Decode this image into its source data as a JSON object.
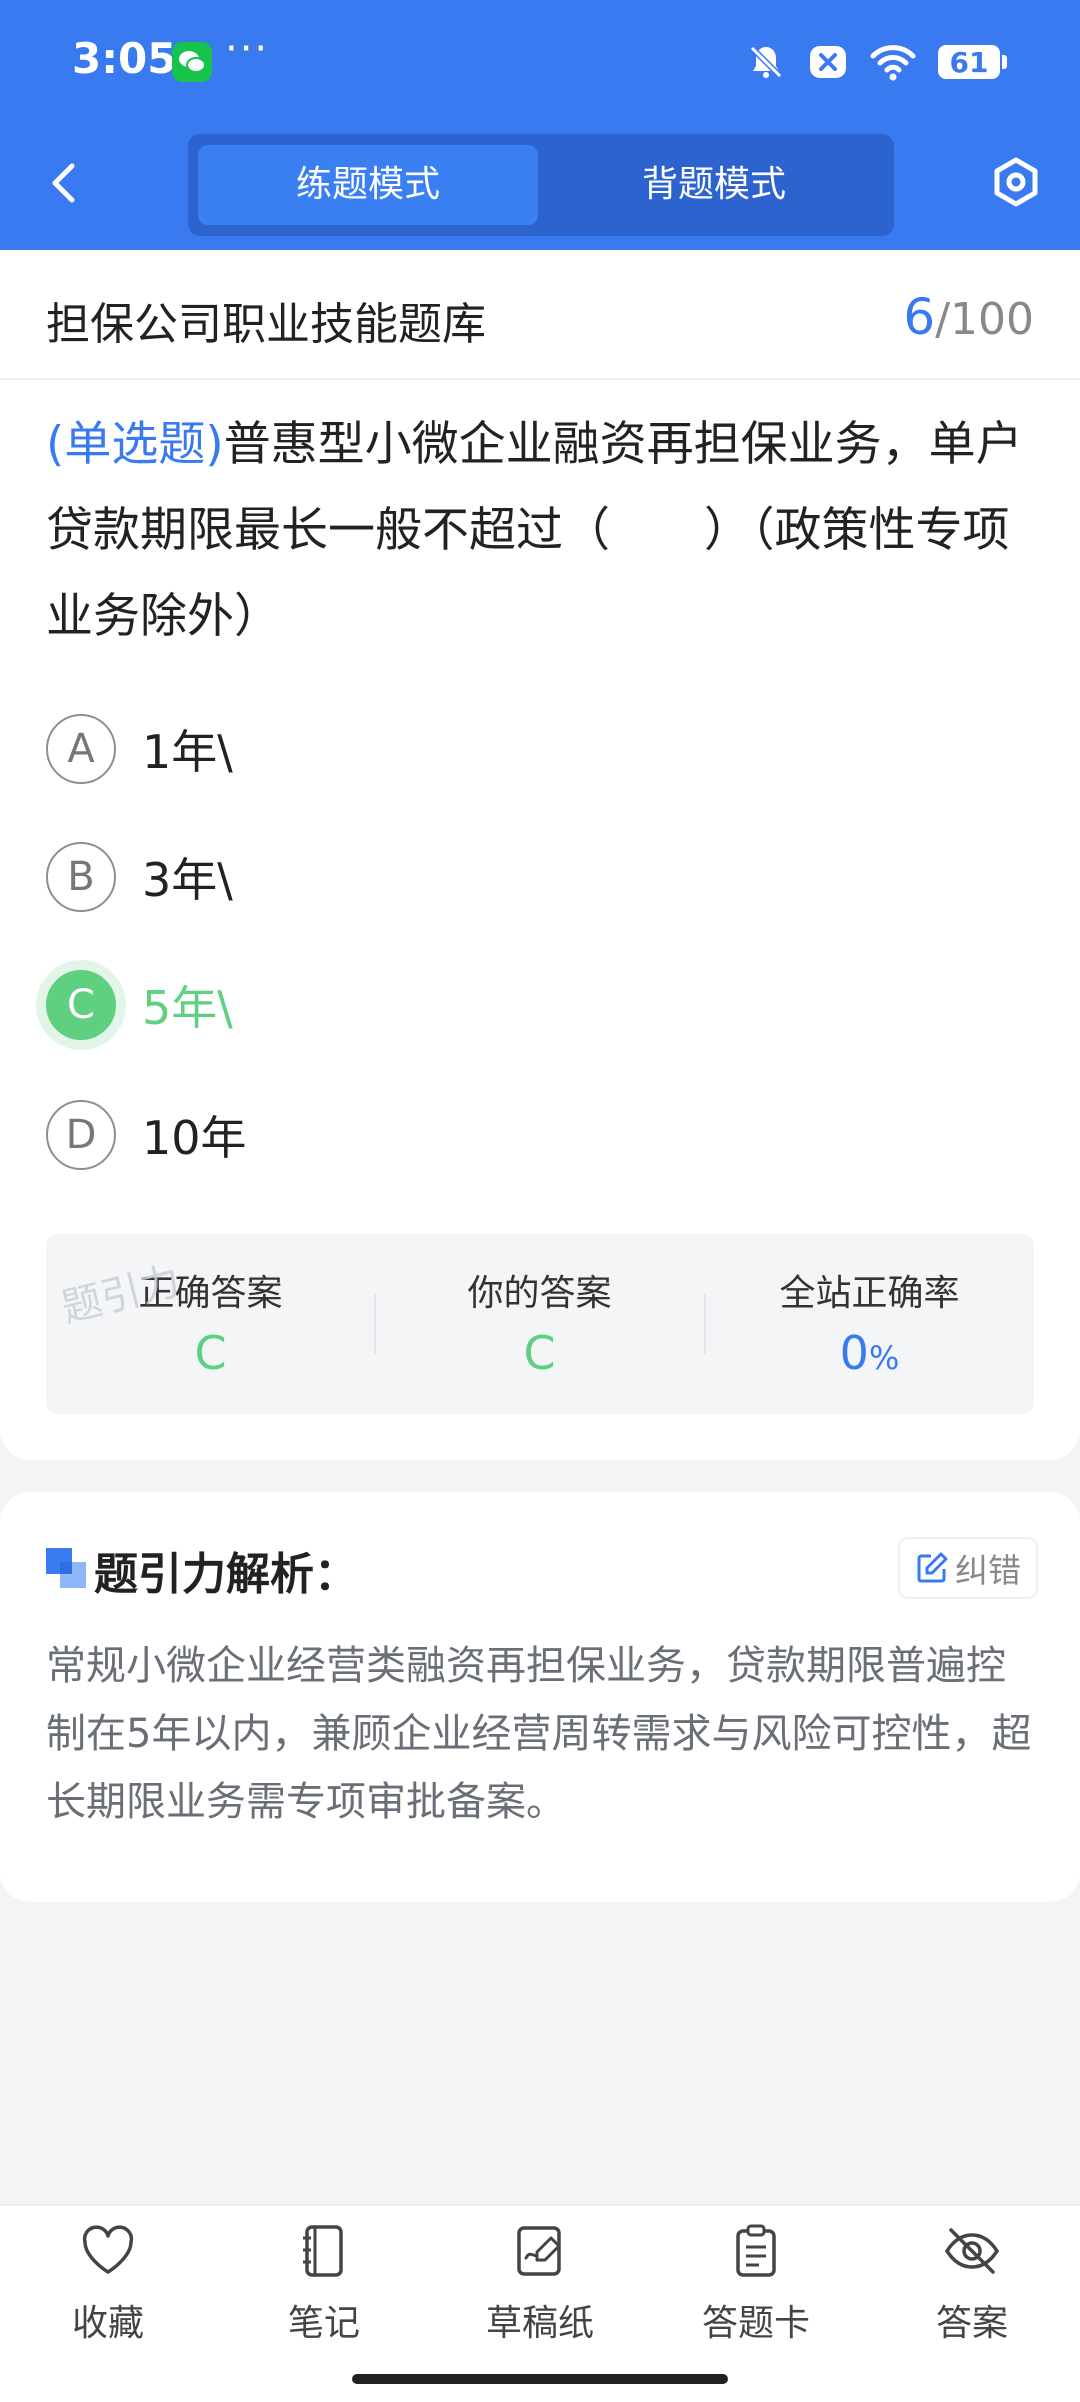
{
  "status_bar": {
    "time": "3:05",
    "dots": "···",
    "battery": "61"
  },
  "nav": {
    "tabs": [
      {
        "label": "练题模式",
        "active": true
      },
      {
        "label": "背题模式",
        "active": false
      }
    ]
  },
  "bank": {
    "title": "担保公司职业技能题库",
    "current": "6",
    "total": "/100"
  },
  "question": {
    "type": "(单选题)",
    "text": "普惠型小微企业融资再担保业务，单户贷款期限最长一般不超过（　　）（政策性专项业务除外）"
  },
  "options": [
    {
      "letter": "A",
      "text": "1年\\",
      "selected": false
    },
    {
      "letter": "B",
      "text": "3年\\",
      "selected": false
    },
    {
      "letter": "C",
      "text": "5年\\",
      "selected": true
    },
    {
      "letter": "D",
      "text": "10年",
      "selected": false
    }
  ],
  "answer_summary": {
    "watermark": "题引力",
    "correct": {
      "label": "正确答案",
      "value": "C"
    },
    "yours": {
      "label": "你的答案",
      "value": "C"
    },
    "rate": {
      "label": "全站正确率",
      "value": "0",
      "unit": "%"
    }
  },
  "analysis": {
    "title": "题引力解析：",
    "correct_button": "纠错",
    "text": "常规小微企业经营类融资再担保业务，贷款期限普遍控制在5年以内，兼顾企业经营周转需求与风险可控性，超长期限业务需专项审批备案。"
  },
  "toolbar": [
    {
      "label": "收藏",
      "icon": "heart-icon"
    },
    {
      "label": "笔记",
      "icon": "notebook-icon"
    },
    {
      "label": "草稿纸",
      "icon": "scratch-paper-icon"
    },
    {
      "label": "答题卡",
      "icon": "answer-card-icon"
    },
    {
      "label": "答案",
      "icon": "eye-off-icon"
    }
  ],
  "colors": {
    "primary": "#3a7af0",
    "correct": "#5fcf80",
    "text_secondary": "#6a6f77"
  }
}
